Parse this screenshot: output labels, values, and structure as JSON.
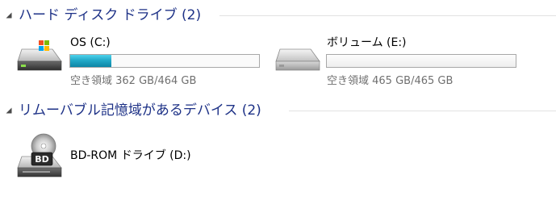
{
  "groups": [
    {
      "title": "ハード ディスク ドライブ (2)"
    },
    {
      "title": "リムーバブル記憶域があるデバイス (2)"
    }
  ],
  "drives": [
    {
      "name": "OS (C:)",
      "space_text": "空き領域 362 GB/464 GB",
      "used_fraction": 0.22,
      "icon": "windows-hard-drive-icon"
    },
    {
      "name": "ボリューム (E:)",
      "space_text": "空き領域 465 GB/465 GB",
      "used_fraction": 0.0,
      "icon": "hard-drive-icon"
    }
  ],
  "removable": [
    {
      "name": "BD-ROM ドライブ (D:)",
      "icon": "bd-rom-drive-icon",
      "icon_label": "BD"
    }
  ],
  "colors": {
    "group_title": "#1e3287",
    "usage_bar": "#26a8c8",
    "space_text": "#707070"
  }
}
